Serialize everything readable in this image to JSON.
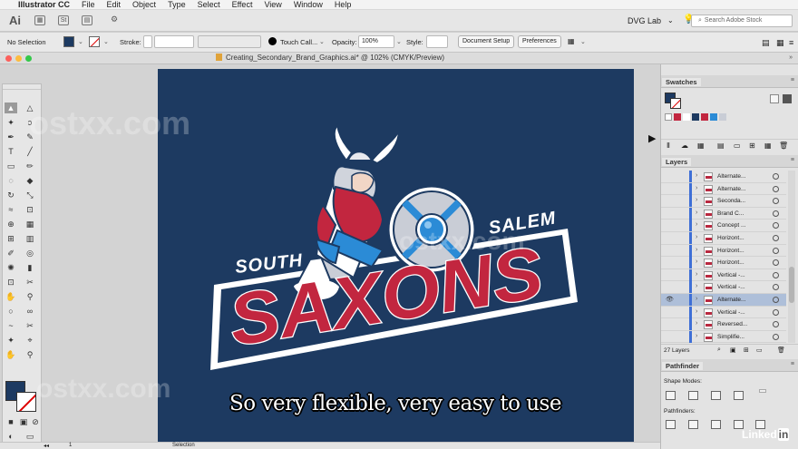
{
  "menubar": {
    "app": "Illustrator CC",
    "items": [
      "File",
      "Edit",
      "Object",
      "Type",
      "Select",
      "Effect",
      "View",
      "Window",
      "Help"
    ]
  },
  "appbar": {
    "logo": "Ai",
    "workspace": "DVG Lab",
    "search_placeholder": "Search Adobe Stock"
  },
  "control": {
    "selection": "No Selection",
    "stroke_label": "Stroke:",
    "brush": "Touch Call...",
    "opacity_label": "Opacity:",
    "opacity_value": "100%",
    "style_label": "Style:",
    "doc_setup": "Document Setup",
    "preferences": "Preferences"
  },
  "document": {
    "title": "Creating_Secondary_Brand_Graphics.ai* @ 102% (CMYK/Preview)"
  },
  "artwork": {
    "word_left": "SOUTH",
    "word_right": "SALEM",
    "main_word": "SAXONS",
    "colors": {
      "navy": "#1d3a61",
      "red": "#c2263f",
      "blue": "#2b8bd6",
      "white": "#ffffff"
    }
  },
  "panels": {
    "swatches": "Swatches",
    "layers": "Layers",
    "layers_count": "27 Layers",
    "pathfinder": "Pathfinder",
    "shape_modes": "Shape Modes:",
    "pathfinders": "Pathfinders:",
    "layer_items": [
      "Alternate...",
      "Alternate...",
      "Seconda...",
      "Brand C...",
      "Concept ...",
      "Horizont...",
      "Horizont...",
      "Horizont...",
      "Vertical -...",
      "Vertical -...",
      "Alternate...",
      "Vertical -...",
      "Reversed...",
      "Simplifie..."
    ],
    "active_layer_index": 10
  },
  "status": {
    "zoom": "102%",
    "page": "1",
    "tool": "Selection"
  },
  "caption": "So very flexible, very easy to use",
  "watermark": "ostxx.com",
  "brand": "Linked"
}
